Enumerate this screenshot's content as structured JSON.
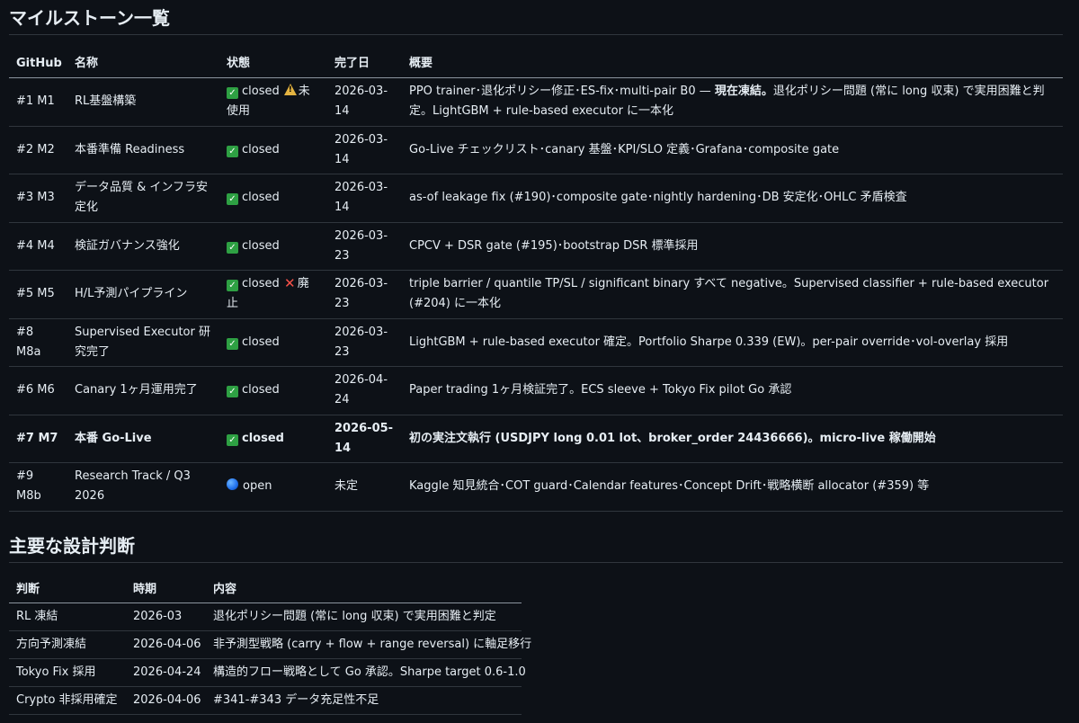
{
  "milestones": {
    "title": "マイルストーン一覧",
    "headers": [
      "GitHub",
      "名称",
      "状態",
      "完了日",
      "概要"
    ],
    "rows": [
      {
        "gh": "#1 M1",
        "name": "RL基盤構築",
        "status": "closed",
        "status_icon": "check",
        "extra_icon": "warning",
        "extra": "未使用",
        "date": "2026-03-14",
        "sum_a": "PPO trainer･退化ポリシー修正･ES-fix･multi-pair B0 — ",
        "sum_b": "現在凍結。",
        "sum_c": "退化ポリシー問題 (常に long 収束) で実用困難と判定。LightGBM + rule-based executor に一本化"
      },
      {
        "gh": "#2 M2",
        "name": "本番準備 Readiness",
        "status": "closed",
        "status_icon": "check",
        "date": "2026-03-14",
        "sum_a": "Go-Live チェックリスト･canary 基盤･KPI/SLO 定義･Grafana･composite gate"
      },
      {
        "gh": "#3 M3",
        "name": "データ品質 & インフラ安定化",
        "status": "closed",
        "status_icon": "check",
        "date": "2026-03-14",
        "sum_a": "as-of leakage fix (#190)･composite gate･nightly hardening･DB 安定化･OHLC 矛盾検査"
      },
      {
        "gh": "#4 M4",
        "name": "検証ガバナンス強化",
        "status": "closed",
        "status_icon": "check",
        "date": "2026-03-23",
        "sum_a": "CPCV + DSR gate (#195)･bootstrap DSR 標準採用"
      },
      {
        "gh": "#5 M5",
        "name": "H/L予測パイプライン",
        "status": "closed",
        "status_icon": "check",
        "extra_icon": "cross",
        "extra": "廃止",
        "date": "2026-03-23",
        "sum_a": "triple barrier / quantile TP/SL / significant binary すべて negative。Supervised classifier + rule-based executor (#204) に一本化"
      },
      {
        "gh": "#8 M8a",
        "name": "Supervised Executor 研究完了",
        "status": "closed",
        "status_icon": "check",
        "date": "2026-03-23",
        "sum_a": "LightGBM + rule-based executor 確定。Portfolio Sharpe 0.339 (EW)。per-pair override･vol-overlay 採用"
      },
      {
        "gh": "#6 M6",
        "name": "Canary 1ヶ月運用完了",
        "status": "closed",
        "status_icon": "check",
        "date": "2026-04-24",
        "sum_a": "Paper trading 1ヶ月検証完了。ECS sleeve + Tokyo Fix pilot Go 承認"
      },
      {
        "gh": "#7 M7",
        "name": "本番 Go-Live",
        "status": "closed",
        "status_icon": "check",
        "date": "2026-05-14",
        "bold": true,
        "sum_a": "初の実注文執行 (USDJPY long 0.01 lot、broker_order 24436666)。micro-live 稼働開始"
      },
      {
        "gh": "#9 M8b",
        "name": "Research Track / Q3 2026",
        "status": "open",
        "status_icon": "open",
        "date": "未定",
        "sum_a": "Kaggle 知見統合･COT guard･Calendar features･Concept Drift･戦略横断 allocator (#359) 等"
      }
    ]
  },
  "decisions": {
    "title": "主要な設計判断",
    "headers": [
      "判断",
      "時期",
      "内容"
    ],
    "rows": [
      {
        "d": "RL 凍結",
        "t": "2026-03",
        "c": "退化ポリシー問題 (常に long 収束) で実用困難と判定"
      },
      {
        "d": "方向予測凍結",
        "t": "2026-04-06",
        "c": "非予測型戦略 (carry + flow + range reversal) に軸足移行"
      },
      {
        "d": "Tokyo Fix 採用",
        "t": "2026-04-24",
        "c": "構造的フロー戦略として Go 承認。Sharpe target 0.6-1.0"
      },
      {
        "d": "Crypto 非採用確定",
        "t": "2026-04-06",
        "c": "#341-#343 データ充足性不足"
      }
    ]
  },
  "icons": {
    "check": "check-icon",
    "warning": "warning-icon",
    "cross": "cross-icon",
    "open": "blue-circle-icon"
  },
  "colors": {
    "background": "#0d1117",
    "text": "#e6edf3",
    "border": "#30363d",
    "check": "#2ea043",
    "warning": "#e3b341",
    "cross": "#f85149",
    "open": "#1f6feb"
  }
}
